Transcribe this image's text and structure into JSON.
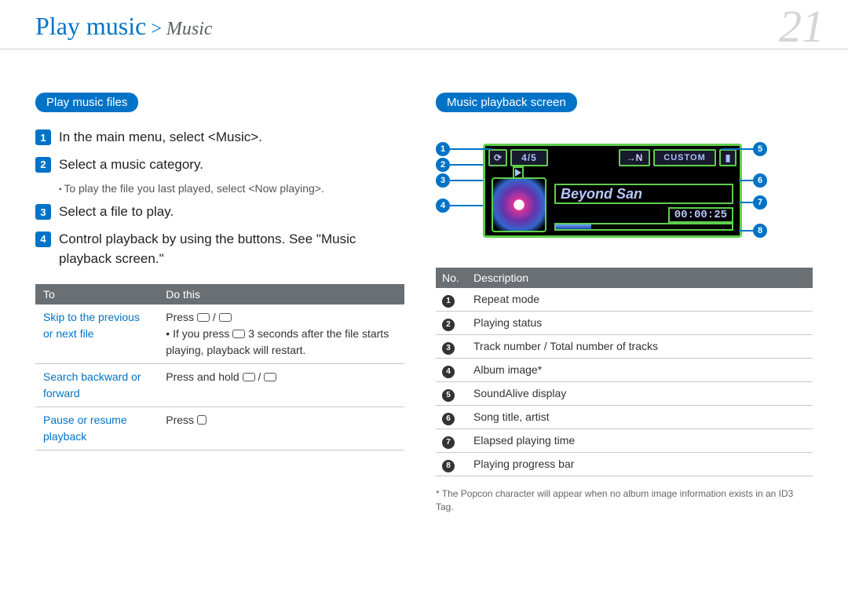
{
  "header": {
    "breadcrumb_main": "Play music",
    "breadcrumb_sep": ">",
    "breadcrumb_sub": "Music",
    "page_number": "21"
  },
  "left": {
    "pill": "Play music files",
    "steps": [
      {
        "n": "1",
        "text": "In the main menu, select <Music>."
      },
      {
        "n": "2",
        "text": "Select a music category."
      },
      {
        "n": "3",
        "text": "Select a file to play."
      },
      {
        "n": "4",
        "text": "Control playback by using the buttons. See \"Music playback screen.\""
      }
    ],
    "step2_sub": "To play the file you last played, select <Now playing>.",
    "table": {
      "head_to": "To",
      "head_do": "Do this",
      "rows": [
        {
          "to": "Skip to the previous or next file",
          "do_line1": "Press ",
          "do_bullet": "If you press      3 seconds after the file starts playing, playback will restart."
        },
        {
          "to": "Search backward or forward",
          "do": "Press and hold "
        },
        {
          "to": "Pause or resume playback",
          "do": "Press "
        }
      ]
    }
  },
  "right": {
    "pill": "Music playback screen",
    "screen": {
      "track_counter": "4/5",
      "sa_icon": "→N",
      "custom_label": "CUSTOM",
      "song_title": "Beyond San",
      "elapsed": "00:00:25"
    },
    "desc_head_no": "No.",
    "desc_head_desc": "Description",
    "desc_rows": [
      {
        "n": "1",
        "d": "Repeat mode"
      },
      {
        "n": "2",
        "d": "Playing status"
      },
      {
        "n": "3",
        "d": "Track number / Total number of tracks"
      },
      {
        "n": "4",
        "d": "Album image*"
      },
      {
        "n": "5",
        "d": "SoundAlive display"
      },
      {
        "n": "6",
        "d": "Song title, artist"
      },
      {
        "n": "7",
        "d": "Elapsed playing time"
      },
      {
        "n": "8",
        "d": "Playing progress bar"
      }
    ],
    "footnote": "* The Popcon character will appear when no album image information exists in an ID3 Tag."
  }
}
